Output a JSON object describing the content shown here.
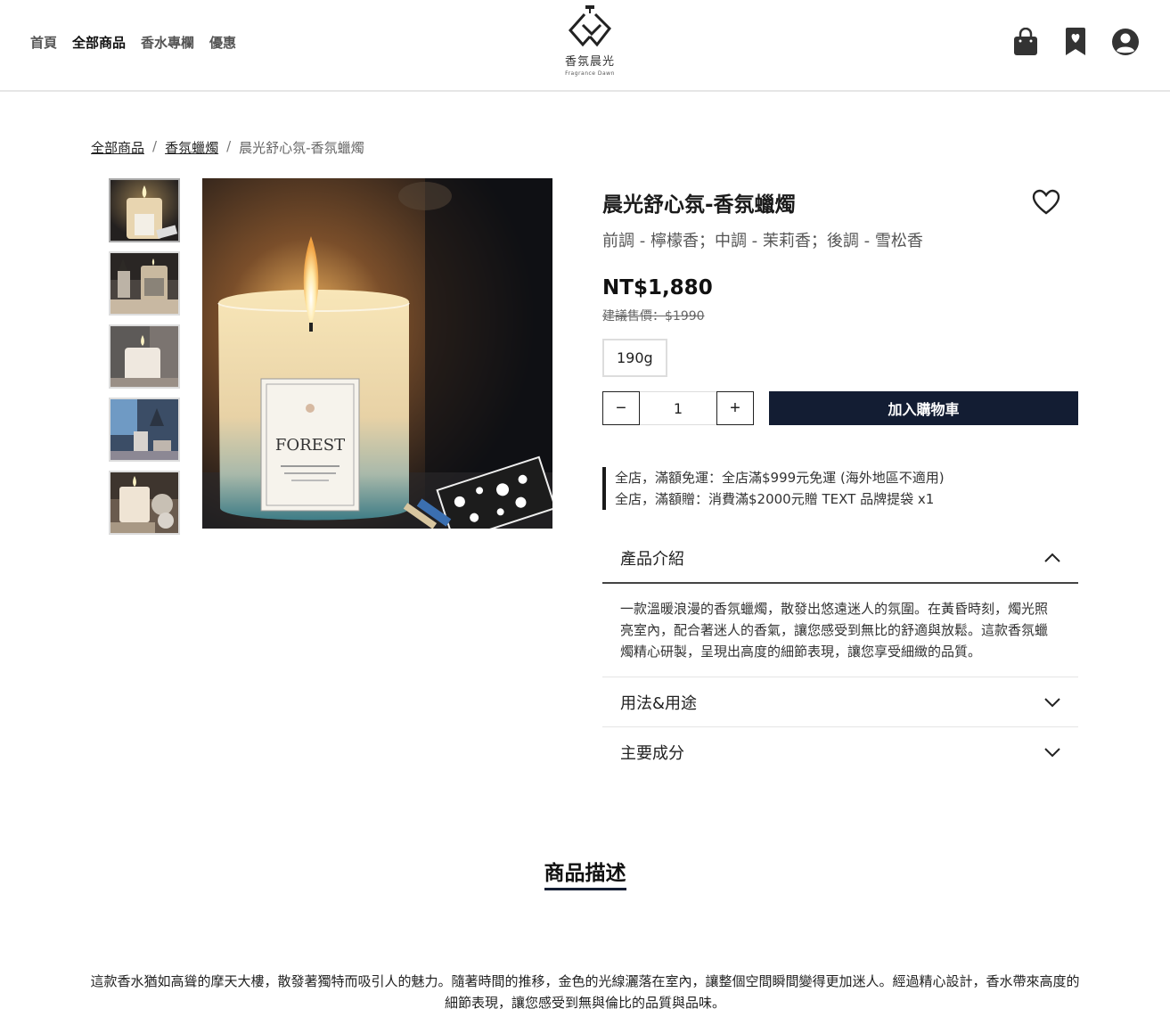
{
  "header": {
    "nav": [
      "首頁",
      "全部商品",
      "香水專欄",
      "優惠"
    ],
    "active_nav": "全部商品",
    "logo_cn": "香氛晨光",
    "logo_en": "Fragrance Dawn",
    "icons": [
      "shopping-bag-icon",
      "bookmark-icon",
      "user-account-icon"
    ]
  },
  "breadcrumb": {
    "items": [
      "全部商品",
      "香氛蠟燭",
      "晨光舒心氛-香氛蠟燭"
    ],
    "separator": "/"
  },
  "gallery": {
    "thumbnail_count": 5,
    "main_label": "FOREST"
  },
  "product": {
    "title": "晨光舒心氛-香氛蠟燭",
    "notes": "前調 - 檸檬香；中調 - 茉莉香；後調 - 雪松香",
    "price": "NT$1,880",
    "original_price": "建議售價：$1990",
    "variant": "190g",
    "quantity": "1",
    "add_to_cart": "加入購物車",
    "qty_minus": "−",
    "qty_plus": "+"
  },
  "promotions": [
    "全店，滿額免運：全店滿$999元免運 (海外地區不適用)",
    "全店，滿額贈：消費滿$2000元贈 TEXT 品牌提袋 x1"
  ],
  "accordion": [
    {
      "title": "產品介紹",
      "open": true,
      "body": "一款溫暖浪漫的香氛蠟燭，散發出悠遠迷人的氛圍。在黃昏時刻，燭光照亮室內，配合著迷人的香氣，讓您感受到無比的舒適與放鬆。這款香氛蠟燭精心研製，呈現出高度的細節表現，讓您享受細緻的品質。"
    },
    {
      "title": "用法&用途",
      "open": false
    },
    {
      "title": "主要成分",
      "open": false
    }
  ],
  "description": {
    "title": "商品描述",
    "text": "這款香水猶如高聳的摩天大樓，散發著獨特而吸引人的魅力。隨著時間的推移，金色的光線灑落在室內，讓整個空間瞬間變得更加迷人。經過精心設計，香水帶來高度的細節表現，讓您感受到無與倫比的品質與品味。"
  },
  "colors": {
    "primary_button": "#131d33",
    "text": "#1a1a1a",
    "muted": "#555555"
  }
}
